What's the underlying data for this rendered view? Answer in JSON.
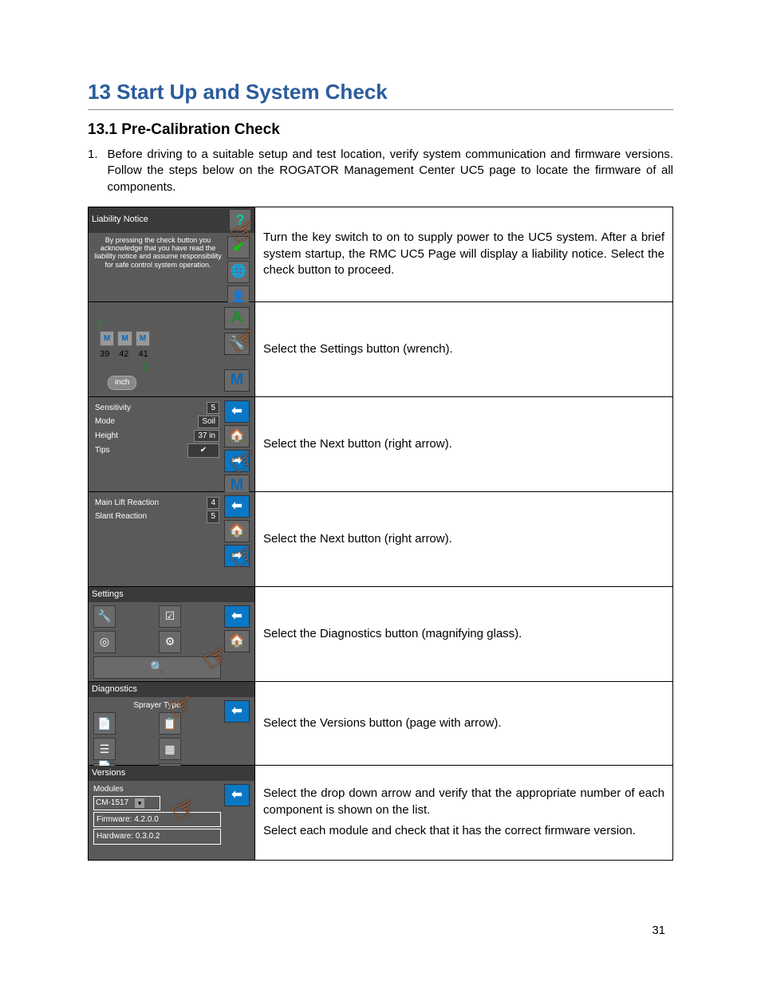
{
  "heading": "13  Start Up and System Check",
  "subheading": "13.1  Pre-Calibration Check",
  "intro": {
    "number": "1.",
    "text": "Before driving to a suitable setup and test location, verify system communication and firmware versions. Follow the steps below on the ROGATOR Management Center UC5 page to locate the firmware of all components."
  },
  "steps": [
    {
      "panel": {
        "title": "Liability Notice",
        "body": "By pressing the check button you acknowledge that you have read the liability notice and assume responsibility for safe control system operation."
      },
      "instruction": "Turn the key switch to on to supply power to the UC5 system. After a brief system startup, the RMC UC5 Page will display a liability notice.  Select the check button to proceed."
    },
    {
      "panel": {
        "values": [
          "39",
          "42",
          "41"
        ],
        "unit": "inch"
      },
      "instruction": "Select the Settings button (wrench)."
    },
    {
      "panel": {
        "rows": [
          {
            "label": "Sensitivity",
            "value": "5"
          },
          {
            "label": "Mode",
            "value": "Soil"
          },
          {
            "label": "Height",
            "value": "37 in"
          },
          {
            "label": "Tips",
            "value": "✔"
          }
        ]
      },
      "instruction": "Select the Next button (right arrow)."
    },
    {
      "panel": {
        "rows": [
          {
            "label": "Main Lift Reaction",
            "value": "4"
          },
          {
            "label": "Slant Reaction",
            "value": "5"
          }
        ]
      },
      "instruction": "Select the Next button (right arrow)."
    },
    {
      "panel": {
        "title": "Settings"
      },
      "instruction": "Select the Diagnostics button (magnifying glass)."
    },
    {
      "panel": {
        "title": "Diagnostics",
        "sub": "Sprayer Type"
      },
      "instruction": "Select the Versions button (page with arrow)."
    },
    {
      "panel": {
        "title": "Versions",
        "modules_label": "Modules",
        "module": "CM-1517",
        "firmware": "Firmware: 4.2.0.0",
        "hardware": "Hardware: 0.3.0.2"
      },
      "instruction_a": "Select the drop down arrow and verify that the appropriate number of each component is shown on the list.",
      "instruction_b": "Select each module and check that it has the correct firmware version."
    }
  ],
  "page_number": "31"
}
